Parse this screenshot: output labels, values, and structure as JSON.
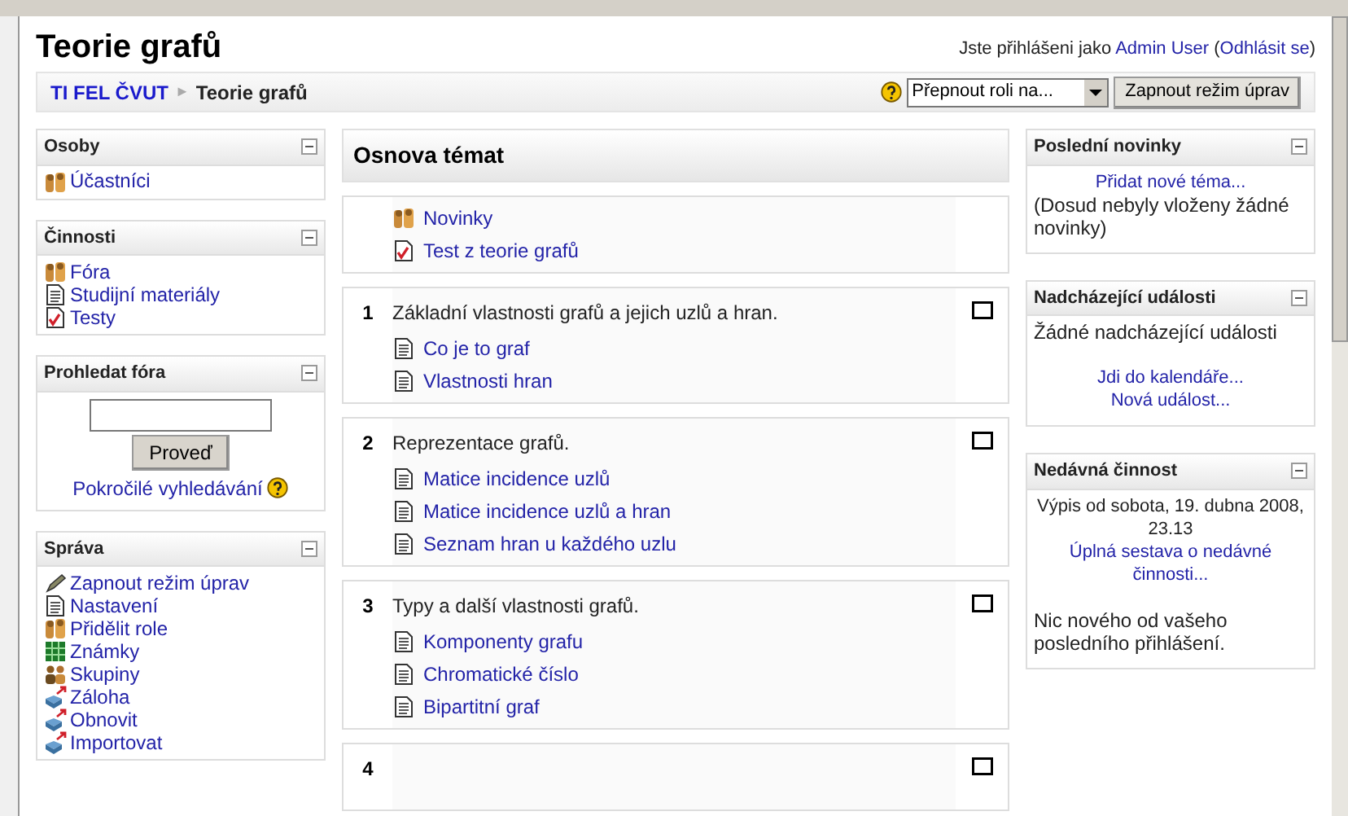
{
  "header": {
    "title": "Teorie grafů",
    "login_prefix": "Jste přihlášeni jako",
    "user": "Admin User",
    "logout_open": "(",
    "logout": "Odhlásit se",
    "logout_close": ")"
  },
  "breadcrumb": {
    "items": [
      "TI FEL ČVUT",
      "Teorie grafů"
    ],
    "separator": "►"
  },
  "navbar_controls": {
    "role_select": "Přepnout roli na...",
    "edit_button": "Zapnout režim úprav"
  },
  "left_blocks": [
    {
      "title": "Osoby",
      "kind": "links",
      "items": [
        {
          "kind": "people",
          "label": "Účastníci"
        }
      ]
    },
    {
      "title": "Činnosti",
      "kind": "links",
      "items": [
        {
          "kind": "forum",
          "label": "Fóra"
        },
        {
          "kind": "resource",
          "label": "Studijní materiály"
        },
        {
          "kind": "quiz",
          "label": "Testy"
        }
      ]
    },
    {
      "title": "Prohledat fóra",
      "kind": "search",
      "button": "Proveď",
      "link": "Pokročilé vyhledávání"
    },
    {
      "title": "Správa",
      "kind": "links",
      "items": [
        {
          "kind": "edit",
          "label": "Zapnout režim úprav"
        },
        {
          "kind": "resource",
          "label": "Nastavení"
        },
        {
          "kind": "people",
          "label": "Přidělit role"
        },
        {
          "kind": "grades",
          "label": "Známky"
        },
        {
          "kind": "groups",
          "label": "Skupiny"
        },
        {
          "kind": "backup",
          "label": "Záloha"
        },
        {
          "kind": "restore",
          "label": "Obnovit"
        },
        {
          "kind": "restore",
          "label": "Importovat"
        }
      ]
    }
  ],
  "main": {
    "title": "Osnova témat",
    "sections": [
      {
        "items": [
          {
            "kind": "forum",
            "label": "Novinky"
          },
          {
            "kind": "quiz",
            "label": "Test z teorie grafů"
          }
        ]
      },
      {
        "number": "1",
        "summary": "Základní vlastnosti grafů a jejich uzlů a hran.",
        "items": [
          {
            "kind": "resource",
            "label": "Co je to graf"
          },
          {
            "kind": "resource",
            "label": "Vlastnosti hran"
          }
        ]
      },
      {
        "number": "2",
        "summary": "Reprezentace grafů.",
        "items": [
          {
            "kind": "resource",
            "label": "Matice incidence uzlů"
          },
          {
            "kind": "resource",
            "label": "Matice incidence uzlů a hran"
          },
          {
            "kind": "resource",
            "label": "Seznam hran u každého uzlu"
          }
        ]
      },
      {
        "number": "3",
        "summary": "Typy a další vlastnosti grafů.",
        "items": [
          {
            "kind": "resource",
            "label": "Komponenty grafu"
          },
          {
            "kind": "resource",
            "label": "Chromatické číslo"
          },
          {
            "kind": "resource",
            "label": "Bipartitní graf"
          }
        ]
      },
      {
        "number": "4"
      }
    ]
  },
  "right_blocks": [
    {
      "title": "Poslední novinky",
      "lines": [
        {
          "kind": "link",
          "text": "Přidat nové téma..."
        },
        {
          "kind": "text",
          "text": "(Dosud nebyly vloženy žádné novinky)"
        }
      ]
    },
    {
      "title": "Nadcházející události",
      "lines": [
        {
          "kind": "text",
          "text": "Žádné nadcházející události"
        },
        {
          "kind": "gap"
        },
        {
          "kind": "link",
          "text": "Jdi do kalendáře..."
        },
        {
          "kind": "link",
          "text": "Nová událost..."
        }
      ]
    },
    {
      "title": "Nedávná činnost",
      "lines": [
        {
          "kind": "centered",
          "text": "Výpis od sobota, 19. dubna 2008, 23.13"
        },
        {
          "kind": "link",
          "text": "Úplná sestava o nedávné činnosti..."
        },
        {
          "kind": "gap"
        },
        {
          "kind": "text",
          "text": "Nic nového od vašeho posledního přihlášení."
        }
      ]
    }
  ]
}
